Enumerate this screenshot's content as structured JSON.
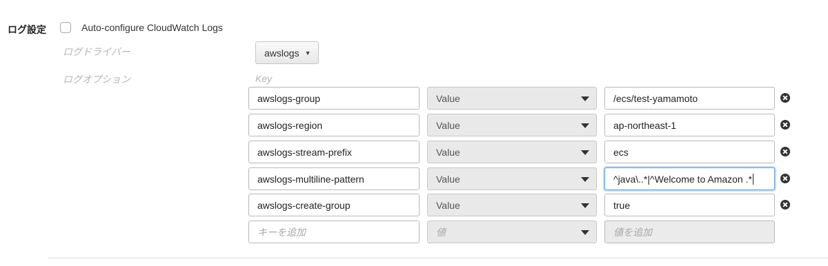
{
  "section": {
    "label": "ログ設定",
    "autoconfigure_label": "Auto-configure CloudWatch Logs",
    "autoconfigure_checked": false
  },
  "log_driver": {
    "label": "ログドライバー",
    "value": "awslogs"
  },
  "log_options": {
    "label": "ログオプション",
    "key_header": "Key",
    "rows": [
      {
        "key": "awslogs-group",
        "type": "Value",
        "value": "/ecs/test-yamamoto"
      },
      {
        "key": "awslogs-region",
        "type": "Value",
        "value": "ap-northeast-1"
      },
      {
        "key": "awslogs-stream-prefix",
        "type": "Value",
        "value": "ecs"
      },
      {
        "key": "awslogs-multiline-pattern",
        "type": "Value",
        "value": "^java\\..*|^Welcome to Amazon .*"
      },
      {
        "key": "awslogs-create-group",
        "type": "Value",
        "value": "true"
      }
    ],
    "new_row": {
      "key_placeholder": "キーを追加",
      "type_placeholder": "値",
      "value_placeholder": "値を追加"
    }
  },
  "icons": {
    "remove": "remove-circle-icon",
    "dropdown": "chevron-down-icon"
  },
  "colors": {
    "focus_border": "#5b9dd9",
    "select_bg": "#e9e9e9",
    "placeholder": "#a8a8a8"
  }
}
